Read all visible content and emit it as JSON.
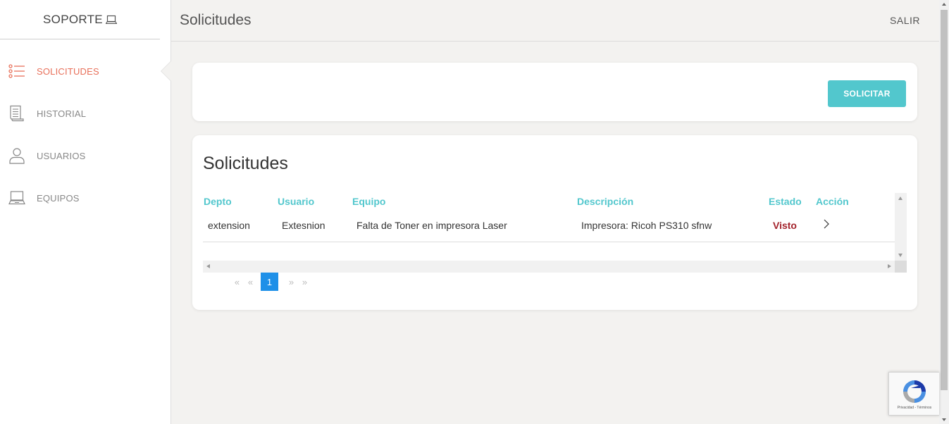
{
  "sidebar": {
    "brand": "SOPORTE",
    "items": [
      {
        "label": "SOLICITUDES",
        "icon": "list-icon",
        "active": true
      },
      {
        "label": "HISTORIAL",
        "icon": "document-icon",
        "active": false
      },
      {
        "label": "USUARIOS",
        "icon": "user-icon",
        "active": false
      },
      {
        "label": "EQUIPOS",
        "icon": "laptop-icon",
        "active": false
      }
    ]
  },
  "header": {
    "title": "Solicitudes",
    "logout_label": "SALIR"
  },
  "toolbar": {
    "request_button_label": "SOLICITAR"
  },
  "requests_panel": {
    "title": "Solicitudes",
    "columns": [
      "Depto",
      "Usuario",
      "Equipo",
      "Descripción",
      "Estado",
      "Acción"
    ],
    "rows": [
      {
        "depto": "extension",
        "usuario": "Extesnion",
        "equipo": "Falta de Toner en impresora Laser",
        "descripcion": "Impresora: Ricoh PS310 sfnw",
        "estado": "Visto",
        "accion_icon": "chevron-right-icon"
      }
    ]
  },
  "pagination": {
    "first": "«",
    "prev": "«",
    "current_page": "1",
    "next": "»",
    "last": "»"
  },
  "recaptcha": {
    "footer": "Privacidad - Términos"
  },
  "colors": {
    "accent": "#52c7cd",
    "active_nav": "#e8705a",
    "status_visto": "#a3222b",
    "page_active": "#1e90e8"
  }
}
